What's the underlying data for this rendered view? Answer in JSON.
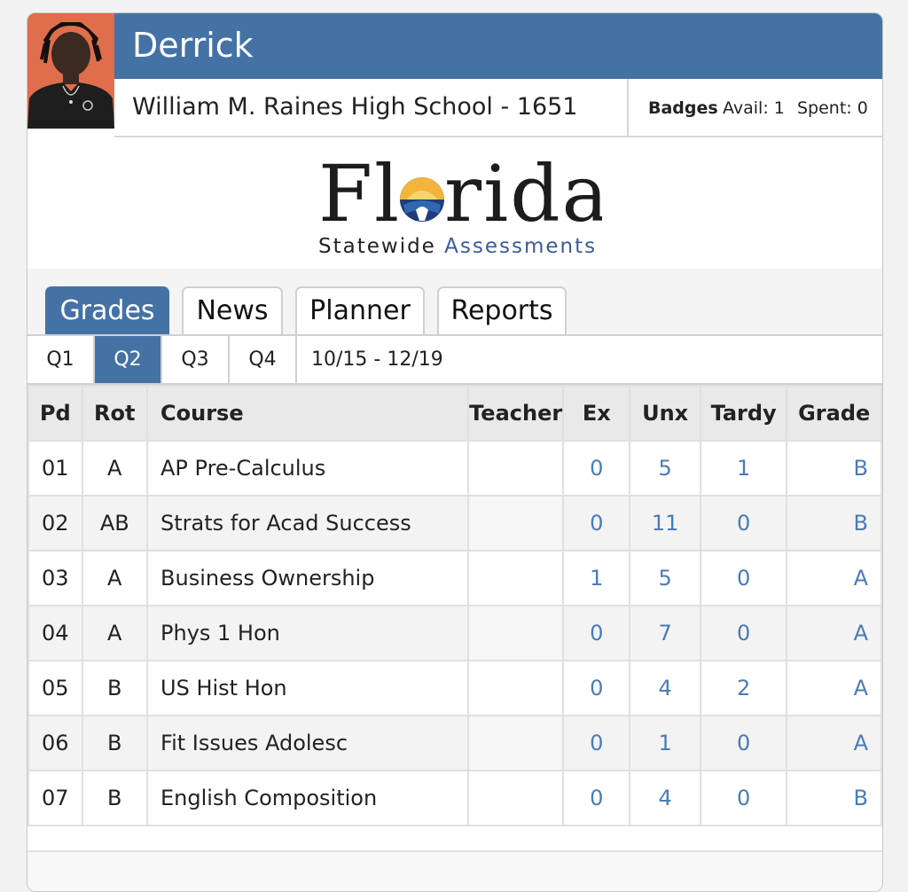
{
  "student": {
    "name": "Derrick",
    "school": "William M. Raines High School - 1651"
  },
  "badges": {
    "label": "Badges",
    "avail": "Avail: 1",
    "spent": "Spent: 0"
  },
  "logo": {
    "word": "Florida",
    "sub_a": "Statewide",
    "sub_b": "Assessments"
  },
  "tabs": [
    {
      "label": "Grades",
      "active": true
    },
    {
      "label": "News",
      "active": false
    },
    {
      "label": "Planner",
      "active": false
    },
    {
      "label": "Reports",
      "active": false
    }
  ],
  "quarters": [
    {
      "label": "Q1",
      "active": false
    },
    {
      "label": "Q2",
      "active": true
    },
    {
      "label": "Q3",
      "active": false
    },
    {
      "label": "Q4",
      "active": false
    }
  ],
  "date_range": "10/15 - 12/19",
  "table": {
    "headers": {
      "pd": "Pd",
      "rot": "Rot",
      "course": "Course",
      "teacher": "Teacher",
      "ex": "Ex",
      "unx": "Unx",
      "tardy": "Tardy",
      "grade": "Grade"
    },
    "rows": [
      {
        "pd": "01",
        "rot": "A",
        "course": "AP Pre-Calculus",
        "teacher": "",
        "ex": "0",
        "unx": "5",
        "tardy": "1",
        "grade": "B"
      },
      {
        "pd": "02",
        "rot": "AB",
        "course": "Strats for Acad Success",
        "teacher": "",
        "ex": "0",
        "unx": "11",
        "tardy": "0",
        "grade": "B"
      },
      {
        "pd": "03",
        "rot": "A",
        "course": "Business Ownership",
        "teacher": "",
        "ex": "1",
        "unx": "5",
        "tardy": "0",
        "grade": "A"
      },
      {
        "pd": "04",
        "rot": "A",
        "course": "Phys 1 Hon",
        "teacher": "",
        "ex": "0",
        "unx": "7",
        "tardy": "0",
        "grade": "A"
      },
      {
        "pd": "05",
        "rot": "B",
        "course": "US Hist Hon",
        "teacher": "",
        "ex": "0",
        "unx": "4",
        "tardy": "2",
        "grade": "A"
      },
      {
        "pd": "06",
        "rot": "B",
        "course": "Fit Issues Adolesc",
        "teacher": "",
        "ex": "0",
        "unx": "1",
        "tardy": "0",
        "grade": "A"
      },
      {
        "pd": "07",
        "rot": "B",
        "course": "English Composition",
        "teacher": "",
        "ex": "0",
        "unx": "4",
        "tardy": "0",
        "grade": "B"
      }
    ]
  },
  "colors": {
    "header_blue": "#4472a5",
    "link_blue": "#4a7bb7",
    "avatar_bg": "#e06d4c"
  }
}
